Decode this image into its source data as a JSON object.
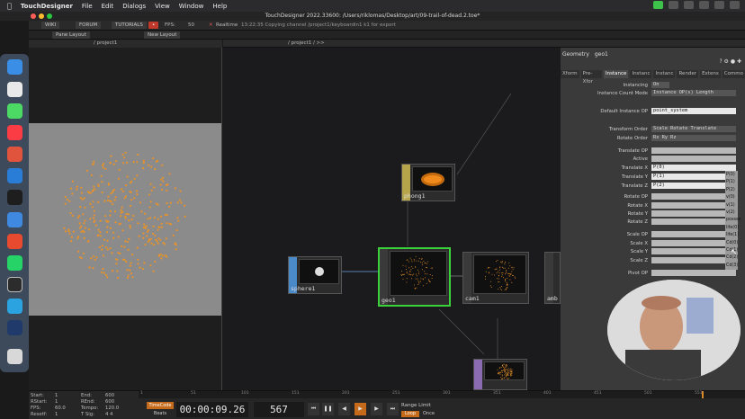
{
  "menubar": {
    "app": "TouchDesigner",
    "items": [
      "File",
      "Edit",
      "Dialogs",
      "View",
      "Window",
      "Help"
    ]
  },
  "window": {
    "title": "TouchDesigner 2022.33600: /Users/riklomas/Desktop/art/09-trail-of-dead.2.toe*"
  },
  "toolbar": {
    "wiki": "WIKI",
    "forum": "FORUM",
    "tutorials": "TUTORIALS",
    "fps_label": "FPS:",
    "fps_value": "50",
    "realtime": "Realtime",
    "status": "13:22:35 Copying channel /project1/keyboardin1 k1 for export",
    "pane_layout": "Pane Layout",
    "new_layout": "New Layout",
    "path_left": "/ project1",
    "path_right": "/ project1 / >>"
  },
  "nodes": {
    "phong": "phong1",
    "sphere": "sphere1",
    "geo": "geo1",
    "cam": "cam1",
    "amb": "amb"
  },
  "params": {
    "header": "Geometry",
    "node_name": "geo1",
    "tabs": [
      "Xform",
      "Pre-Xfor",
      "Instance",
      "Instanc",
      "Instanc",
      "Render",
      "Extens",
      "Commo"
    ],
    "rows": [
      {
        "label": "Instancing",
        "value": "On"
      },
      {
        "label": "Instance Count Mode",
        "value": "Instance OP(s) Length"
      },
      {
        "label": "Default Instance OP",
        "value": "point_system"
      },
      {
        "label": "Transform Order",
        "value": "Scale Rotate Translate"
      },
      {
        "label": "Rotate Order",
        "value": "Rx Ry Rz"
      },
      {
        "label": "Translate OP",
        "value": ""
      },
      {
        "label": "Active",
        "value": ""
      },
      {
        "label": "Translate X",
        "value": "P(0)"
      },
      {
        "label": "Translate Y",
        "value": "P(1)"
      },
      {
        "label": "Translate Z",
        "value": "P(2)"
      },
      {
        "label": "Rotate OP",
        "value": ""
      },
      {
        "label": "Rotate X",
        "value": ""
      },
      {
        "label": "Rotate Y",
        "value": ""
      },
      {
        "label": "Rotate Z",
        "value": ""
      },
      {
        "label": "Scale OP",
        "value": ""
      },
      {
        "label": "Scale X",
        "value": ""
      },
      {
        "label": "Scale Y",
        "value": ""
      },
      {
        "label": "Scale Z",
        "value": ""
      },
      {
        "label": "Pivot OP",
        "value": ""
      }
    ],
    "dropdown": [
      "P(0)",
      "P(1)",
      "P(2)",
      "v(0)",
      "v(1)",
      "v(2)",
      "possso",
      "life(0)",
      "life(1)",
      "Cd(0)",
      "Cd(1)",
      "Cd(2)",
      "Cd(3)"
    ]
  },
  "timeline": {
    "stats": [
      {
        "label": "Start:",
        "value": "1"
      },
      {
        "label": "End:",
        "value": "600"
      },
      {
        "label": "RStart:",
        "value": "1"
      },
      {
        "label": "REnd:",
        "value": "600"
      },
      {
        "label": "FPS:",
        "value": "60.0"
      },
      {
        "label": "Tempo:",
        "value": "120.0"
      },
      {
        "label": "Resetf:",
        "value": "1"
      },
      {
        "label": "T Sig:",
        "value": "4  4"
      }
    ],
    "ticks": [
      "1",
      "51",
      "101",
      "151",
      "201",
      "251",
      "301",
      "351",
      "401",
      "451",
      "501",
      "551",
      "600"
    ],
    "timecode_label": "TimeCode",
    "beats_label": "Beats",
    "timecode": "00:00:09.26",
    "frame": "567",
    "range_limit": "Range Limit",
    "loop": "Loop",
    "once": "Once"
  },
  "colors": {
    "accent_green": "#3bd13b",
    "particle_orange": "#e8922a",
    "node_yellow": "#b5a44a",
    "node_blue": "#4a8ac9",
    "node_purple": "#8a6ab0"
  }
}
